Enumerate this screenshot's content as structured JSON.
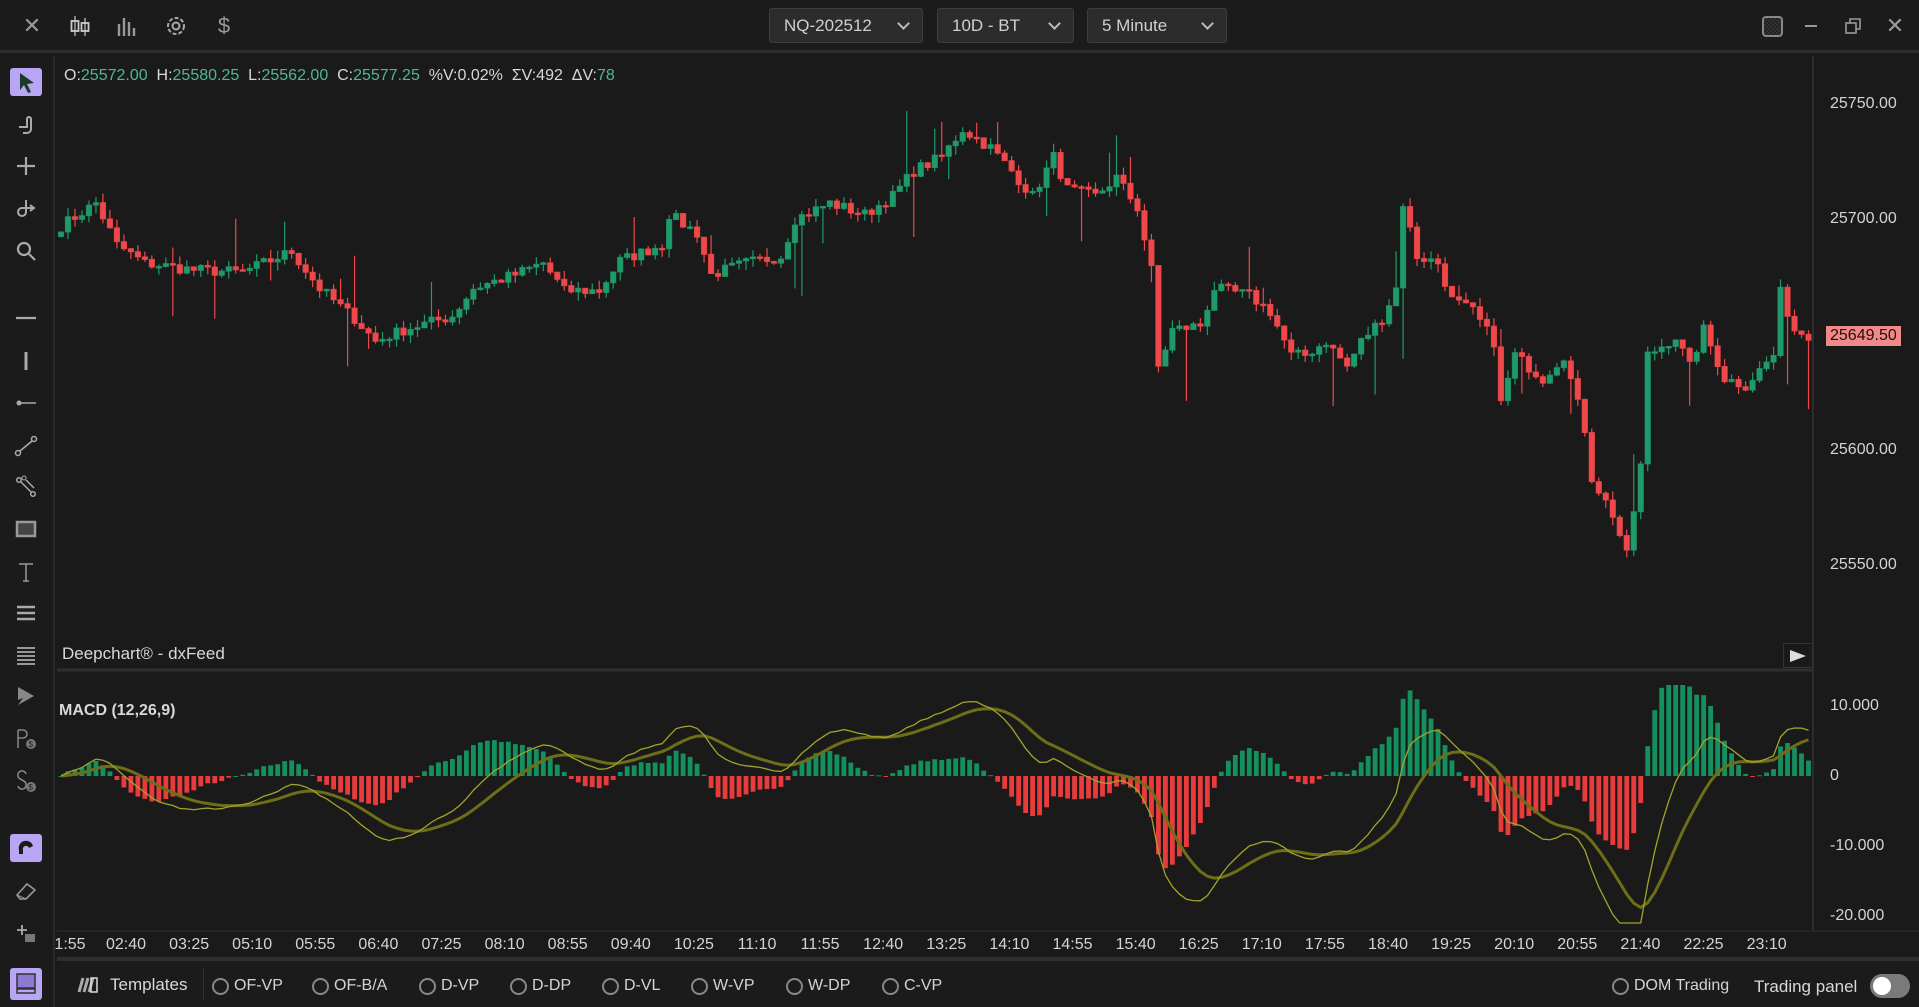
{
  "toolbar": {
    "symbol": "NQ-202512",
    "range": "10D - BT",
    "interval": "5 Minute"
  },
  "ohlc": {
    "o_label": "O:",
    "o": "25572.00",
    "h_label": "H:",
    "h": "25580.25",
    "l_label": "L:",
    "l": "25562.00",
    "c_label": "C:",
    "c": "25577.25",
    "pv_label": "%V:",
    "pv": "0.02%",
    "sv_label": "ΣV:",
    "sv": "492",
    "dv_label": "ΔV:",
    "dv": "78"
  },
  "footer_label": "Deepchart® - dxFeed",
  "price_axis": {
    "ticks": [
      "25750.00",
      "25700.00",
      "25600.00",
      "25550.00"
    ],
    "tick_values": [
      25750,
      25700,
      25600,
      25550
    ],
    "last_price": "25649.50",
    "last_value": 25649.5
  },
  "macd": {
    "title": "MACD (12,26,9)",
    "ticks": [
      "10.000",
      "0",
      "-10.000",
      "-20.000"
    ],
    "tick_values": [
      10,
      0,
      -10,
      -20
    ]
  },
  "time_axis": [
    "1:55",
    "02:40",
    "03:25",
    "05:10",
    "05:55",
    "06:40",
    "07:25",
    "08:10",
    "08:55",
    "09:40",
    "10:25",
    "11:10",
    "11:55",
    "12:40",
    "13:25",
    "14:10",
    "14:55",
    "15:40",
    "16:25",
    "17:10",
    "17:55",
    "18:40",
    "19:25",
    "20:10",
    "20:55",
    "21:40",
    "22:25",
    "23:10"
  ],
  "bottom": {
    "templates": "Templates",
    "options": [
      "OF-VP",
      "OF-B/A",
      "D-VP",
      "D-DP",
      "D-VL",
      "W-VP",
      "W-DP",
      "C-VP"
    ],
    "dom_trading": "DOM Trading",
    "trading_panel": "Trading panel",
    "trading_panel_on": false
  },
  "colors": {
    "up": "#1f9a6a",
    "down": "#f0484a",
    "macd": "#a3a32a",
    "signal": "#6e6e18",
    "accent": "#b8a6f5"
  },
  "chart_data": {
    "type": "candlestick",
    "bars": 251,
    "ylim": [
      25520,
      25765
    ],
    "close_keypoints": [
      [
        0,
        25697
      ],
      [
        5,
        25707
      ],
      [
        8,
        25689
      ],
      [
        12,
        25681
      ],
      [
        19,
        25678
      ],
      [
        26,
        25677
      ],
      [
        33,
        25686
      ],
      [
        37,
        25670
      ],
      [
        42,
        25657
      ],
      [
        45,
        25647
      ],
      [
        49,
        25652
      ],
      [
        56,
        25658
      ],
      [
        59,
        25670
      ],
      [
        65,
        25676
      ],
      [
        69,
        25681
      ],
      [
        72,
        25669
      ],
      [
        77,
        25669
      ],
      [
        80,
        25682
      ],
      [
        86,
        25689
      ],
      [
        87,
        25702
      ],
      [
        91,
        25694
      ],
      [
        93,
        25676
      ],
      [
        98,
        25681
      ],
      [
        103,
        25684
      ],
      [
        105,
        25700
      ],
      [
        110,
        25707
      ],
      [
        115,
        25702
      ],
      [
        119,
        25710
      ],
      [
        122,
        25721
      ],
      [
        126,
        25727
      ],
      [
        129,
        25739
      ],
      [
        133,
        25731
      ],
      [
        136,
        25721
      ],
      [
        139,
        25710
      ],
      [
        142,
        25727
      ],
      [
        144,
        25713
      ],
      [
        148,
        25710
      ],
      [
        151,
        25718
      ],
      [
        154,
        25705
      ],
      [
        156,
        25678
      ],
      [
        157,
        25636
      ],
      [
        159,
        25652
      ],
      [
        163,
        25654
      ],
      [
        165,
        25670
      ],
      [
        170,
        25667
      ],
      [
        173,
        25660
      ],
      [
        176,
        25641
      ],
      [
        178,
        25641
      ],
      [
        181,
        25647
      ],
      [
        184,
        25636
      ],
      [
        186,
        25647
      ],
      [
        189,
        25657
      ],
      [
        191,
        25670
      ],
      [
        192,
        25707
      ],
      [
        194,
        25684
      ],
      [
        197,
        25681
      ],
      [
        199,
        25665
      ],
      [
        202,
        25660
      ],
      [
        205,
        25647
      ],
      [
        206,
        25620
      ],
      [
        208,
        25641
      ],
      [
        212,
        25631
      ],
      [
        215,
        25641
      ],
      [
        218,
        25609
      ],
      [
        219,
        25588
      ],
      [
        222,
        25572
      ],
      [
        224,
        25554
      ],
      [
        226,
        25593
      ],
      [
        227,
        25641
      ],
      [
        231,
        25649
      ],
      [
        233,
        25636
      ],
      [
        235,
        25652
      ],
      [
        238,
        25631
      ],
      [
        241,
        25628
      ],
      [
        245,
        25641
      ],
      [
        246,
        25668
      ],
      [
        248,
        25652
      ],
      [
        250,
        25650
      ]
    ]
  }
}
